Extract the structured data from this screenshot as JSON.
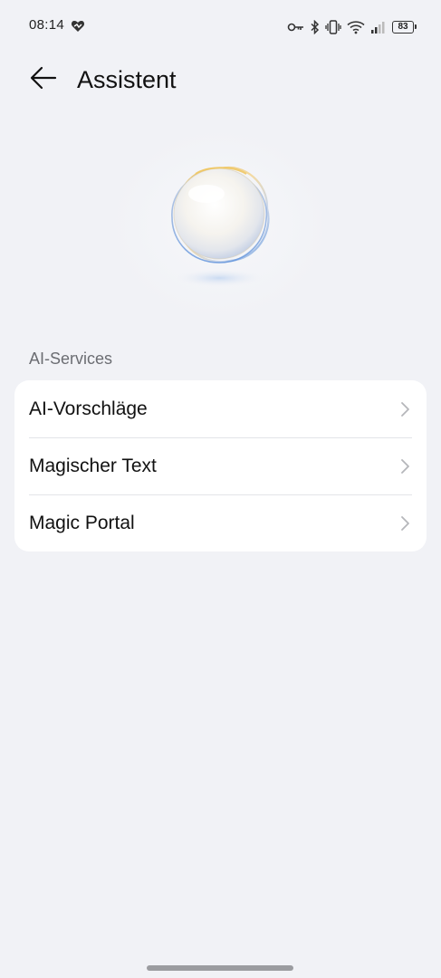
{
  "status_bar": {
    "time": "08:14",
    "battery": "83",
    "icons": [
      "heart-sync-icon",
      "key-icon",
      "bluetooth-icon",
      "vibrate-icon",
      "wifi-icon",
      "signal-icon",
      "battery-icon"
    ]
  },
  "header": {
    "back_icon": "arrow-left-icon",
    "title": "Assistent"
  },
  "hero": {
    "icon": "assistant-orb-icon"
  },
  "section": {
    "label": "AI-Services"
  },
  "list": {
    "items": [
      {
        "label": "AI-Vorschläge",
        "icon": "chevron-right-icon"
      },
      {
        "label": "Magischer Text",
        "icon": "chevron-right-icon"
      },
      {
        "label": "Magic Portal",
        "icon": "chevron-right-icon"
      }
    ]
  },
  "colors": {
    "background": "#f1f2f6",
    "card": "#ffffff",
    "text_primary": "#111111",
    "text_secondary": "#6b6d72",
    "chevron": "#b5b6ba",
    "divider": "#e3e4e8"
  }
}
